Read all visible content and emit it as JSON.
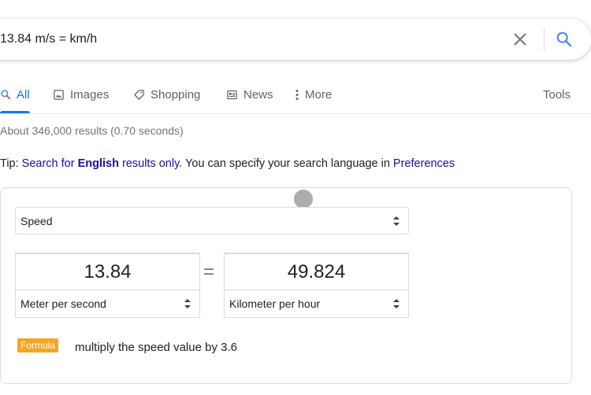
{
  "search": {
    "query": "13.84 m/s = km/h",
    "clear_icon": "close-icon",
    "search_icon": "search-icon"
  },
  "tabs": [
    {
      "label": "All",
      "icon": "search-icon",
      "active": true
    },
    {
      "label": "Images",
      "icon": "image-icon",
      "active": false
    },
    {
      "label": "Shopping",
      "icon": "tag-icon",
      "active": false
    },
    {
      "label": "News",
      "icon": "newspaper-icon",
      "active": false
    },
    {
      "label": "More",
      "icon": "more-vertical-icon",
      "active": false
    }
  ],
  "tools_label": "Tools",
  "result_stats": "About 346,000 results (0.70 seconds)",
  "tip": {
    "prefix": "Tip: ",
    "link_before": "Search for ",
    "bold": "English",
    "link_after": " results only",
    "middle": ". You can specify your search language in ",
    "preferences": "Preferences"
  },
  "converter": {
    "category": "Speed",
    "from_value": "13.84",
    "to_value": "49.824",
    "equals": "=",
    "from_unit": "Meter per second",
    "to_unit": "Kilometer per hour",
    "formula_label": "Formula",
    "formula_text": "multiply the speed value by 3.6"
  },
  "colors": {
    "accent": "#1a73e8",
    "link": "#1a0dab",
    "badge": "#f6a623"
  }
}
